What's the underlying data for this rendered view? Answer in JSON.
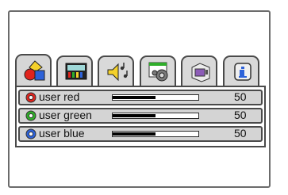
{
  "tabs": [
    {
      "name": "picture-tab",
      "icon": "color-shapes-icon",
      "active": true
    },
    {
      "name": "display-tab",
      "icon": "monitor-bars-icon",
      "active": false
    },
    {
      "name": "audio-tab",
      "icon": "speaker-notes-icon",
      "active": false
    },
    {
      "name": "settings-tab",
      "icon": "gear-window-icon",
      "active": false
    },
    {
      "name": "input-source-tab",
      "icon": "screen-cube-icon",
      "active": false
    },
    {
      "name": "information-tab",
      "icon": "info-icon",
      "active": false
    }
  ],
  "rows": [
    {
      "label": "user red",
      "value": "50",
      "level": 0.5,
      "icon": "red-adjust-icon",
      "icon_color": "#e0241d"
    },
    {
      "label": "user green",
      "value": "50",
      "level": 0.5,
      "icon": "green-adjust-icon",
      "icon_color": "#2fae2a"
    },
    {
      "label": "user blue",
      "value": "50",
      "level": 0.5,
      "icon": "blue-adjust-icon",
      "icon_color": "#2d62d9"
    }
  ]
}
